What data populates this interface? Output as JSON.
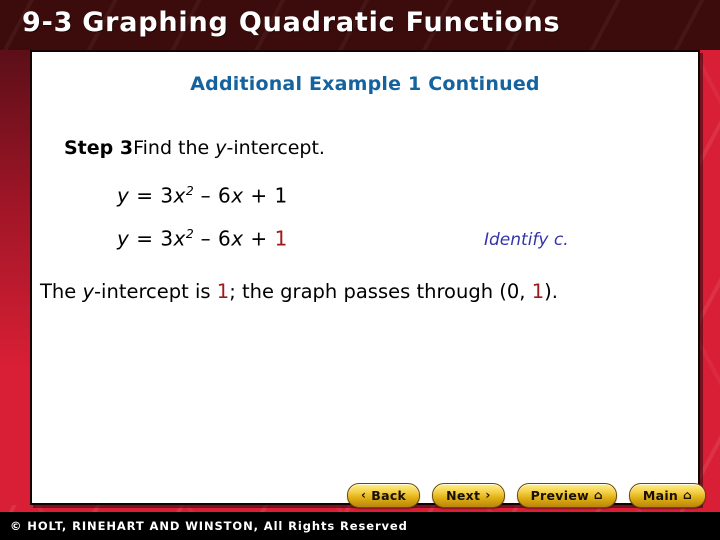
{
  "header": {
    "lesson_number": "9-3",
    "title": "Graphing Quadratic Functions"
  },
  "content": {
    "example_heading": "Additional Example 1 Continued",
    "step": {
      "label": "Step 3",
      "text_before_var": "Find the ",
      "variable": "y",
      "text_after_var": "-intercept."
    },
    "equation_1": {
      "lhs": "y",
      "eq": " = 3",
      "var": "x",
      "exponent": "2",
      "mid": " – 6",
      "var2": "x",
      "tail": " + 1"
    },
    "equation_2": {
      "lhs": "y",
      "eq": " = 3",
      "var": "x",
      "exponent": "2",
      "mid": " – 6",
      "var2": "x",
      "plus": " + ",
      "highlight": "1"
    },
    "identify_note": "Identify c.",
    "conclusion": {
      "part1": "The ",
      "var": "y",
      "part2": "-intercept is ",
      "value1": "1",
      "part3": "; the graph passes through (0, ",
      "value2": "1",
      "part4": ")."
    }
  },
  "nav": {
    "back": {
      "chevron": "‹",
      "label": "Back"
    },
    "next": {
      "label": "Next",
      "chevron": "›"
    },
    "preview": {
      "label": "Preview",
      "home_icon": "⌂"
    },
    "main": {
      "label": "Main",
      "home_icon": "⌂"
    }
  },
  "footer": {
    "copyright": "© HOLT, RINEHART AND WINSTON, All Rights Reserved"
  },
  "colors": {
    "header_bg": "#3c0c0c",
    "slide_red": "#d91f35",
    "heading_blue": "#15639e",
    "highlight_red": "#a0191b",
    "note_blue": "#3434a8",
    "button_gold": "#f4d047"
  }
}
